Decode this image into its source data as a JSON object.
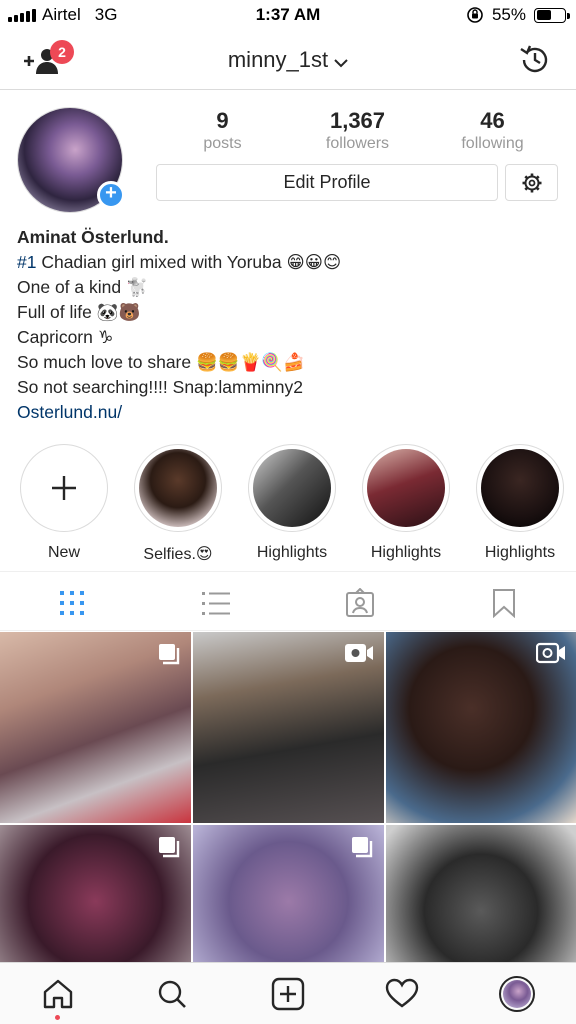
{
  "status_bar": {
    "carrier": "Airtel",
    "network": "3G",
    "time": "1:37 AM",
    "battery": "55%",
    "battery_level": 0.55
  },
  "header": {
    "username": "minny_1st",
    "notification_count": "2"
  },
  "stats": [
    {
      "value": "9",
      "label": "posts"
    },
    {
      "value": "1,367",
      "label": "followers"
    },
    {
      "value": "46",
      "label": "following"
    }
  ],
  "edit_profile_label": "Edit Profile",
  "bio": {
    "name": "Aminat Österlund.",
    "hashtag": "#1",
    "line1_rest": " Chadian girl mixed with Yoruba 😁😀😊",
    "line2": "One of a kind 🐩",
    "line3": "Full of life 🐼🐻",
    "line4": "Capricorn ♑",
    "line5": "So much love to share 🍔🍔🍟🍭🍰",
    "line6": "So not searching!!!! Snap:lamminny2",
    "link": "Osterlund.nu/"
  },
  "highlights": [
    {
      "label": "New"
    },
    {
      "label": "Selfies.😍"
    },
    {
      "label": "Highlights"
    },
    {
      "label": "Highlights"
    },
    {
      "label": "Highlights"
    }
  ],
  "colors": {
    "accent_blue": "#3897f0",
    "badge_red": "#ed4956",
    "link_blue": "#003569",
    "border": "#dbdbdb"
  }
}
